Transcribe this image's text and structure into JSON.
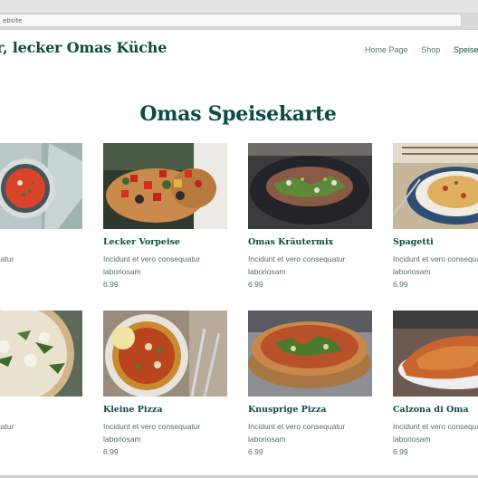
{
  "browser": {
    "address_text": "ebsite"
  },
  "site": {
    "title": "er, lecker Omas Küche"
  },
  "nav": {
    "items": [
      "Home Page",
      "Shop",
      "Speisek"
    ]
  },
  "page": {
    "heading": "Omas Speisekarte"
  },
  "menu": [
    {
      "name": "suppe",
      "desc1": "ero consequatur",
      "desc2": "",
      "price": ""
    },
    {
      "name": "Lecker Vorpeise",
      "desc1": "Incidunt et vero consequatur",
      "desc2": "laboriosam",
      "price": "6.99"
    },
    {
      "name": "Omas Kräutermix",
      "desc1": "Incidunt et vero consequatur",
      "desc2": "laboriosam",
      "price": "6.99"
    },
    {
      "name": "Spagetti",
      "desc1": "Incidunt et vero consequatur",
      "desc2": "laboriosam",
      "price": "6.99"
    },
    {
      "name": "izza",
      "desc1": "ero consequatur",
      "desc2": "",
      "price": ""
    },
    {
      "name": "Kleine Pizza",
      "desc1": "Incidunt et vero consequatur",
      "desc2": "laboriosam",
      "price": "6.99"
    },
    {
      "name": "Knusprige Pizza",
      "desc1": "Incidunt et vero consequatur",
      "desc2": "laboriosam",
      "price": "6.99"
    },
    {
      "name": "Calzona di Oma",
      "desc1": "Incidunt et vero consequatur",
      "desc2": "laboriosam",
      "price": "6.99"
    }
  ],
  "colors": {
    "brand": "#0d4b45",
    "text_muted": "#566e6b"
  }
}
